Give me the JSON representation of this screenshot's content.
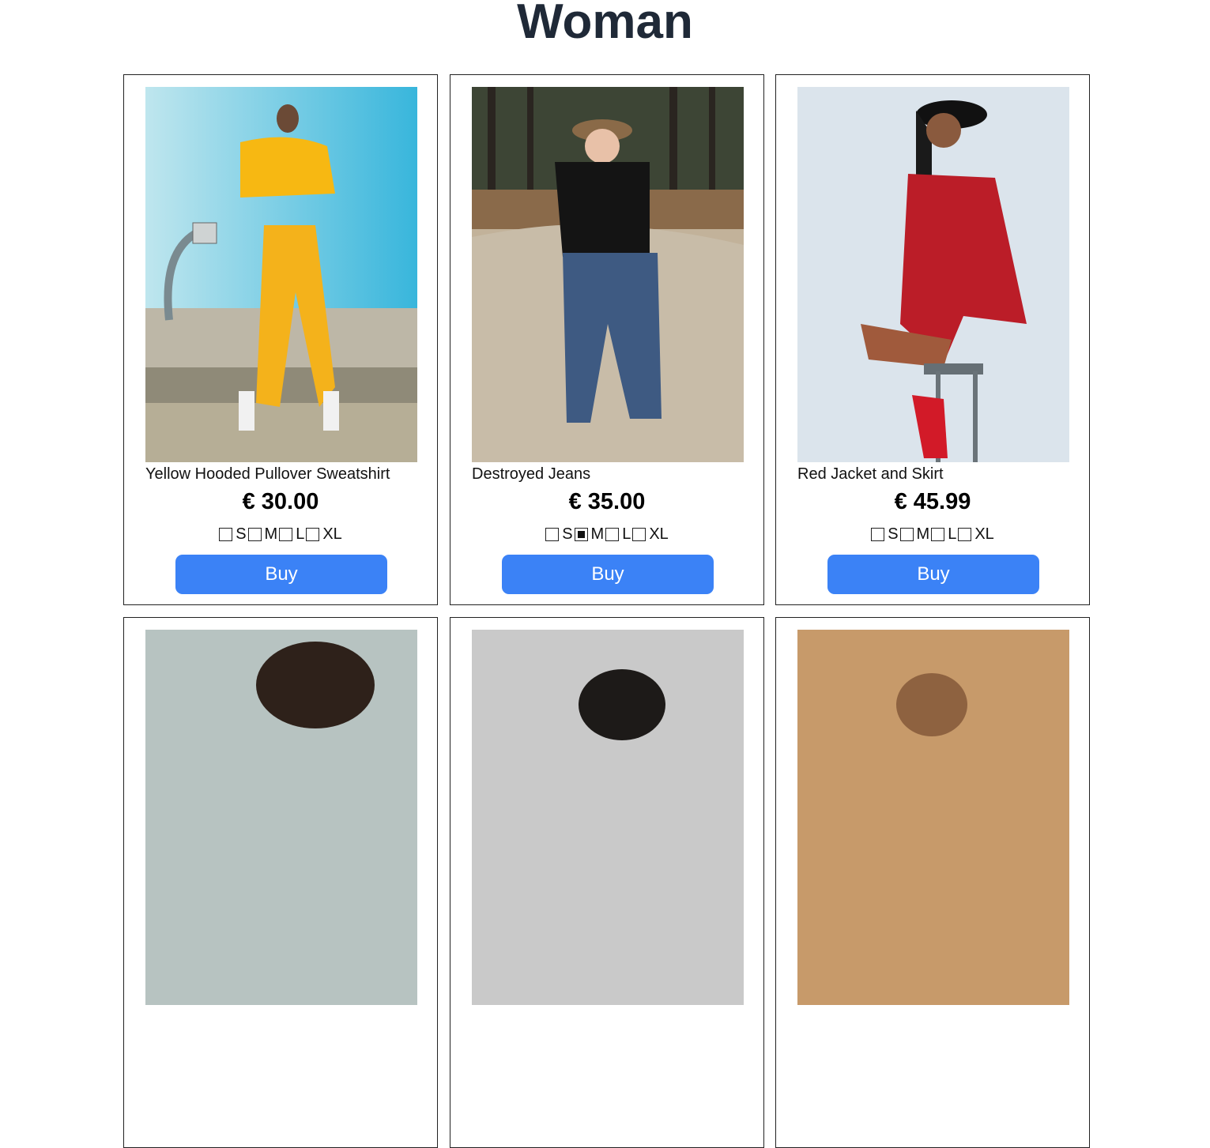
{
  "page": {
    "title": "Woman"
  },
  "colors": {
    "accent": "#3b82f6",
    "title": "#1f2937"
  },
  "products": [
    {
      "name": "Yellow Hooded Pullover Sweatshirt",
      "price": "€ 30.00",
      "sizes": [
        "S",
        "M",
        "L",
        "XL"
      ],
      "selected": [
        false,
        false,
        false,
        false
      ],
      "buy_label": "Buy"
    },
    {
      "name": "Destroyed Jeans",
      "price": "€ 35.00",
      "sizes": [
        "S",
        "M",
        "L",
        "XL"
      ],
      "selected": [
        false,
        true,
        false,
        false
      ],
      "buy_label": "Buy"
    },
    {
      "name": "Red Jacket and Skirt",
      "price": "€ 45.99",
      "sizes": [
        "S",
        "M",
        "L",
        "XL"
      ],
      "selected": [
        false,
        false,
        false,
        false
      ],
      "buy_label": "Buy"
    },
    {
      "name": "",
      "price": "",
      "sizes": [],
      "selected": [],
      "buy_label": ""
    },
    {
      "name": "",
      "price": "",
      "sizes": [],
      "selected": [],
      "buy_label": ""
    },
    {
      "name": "",
      "price": "",
      "sizes": [],
      "selected": [],
      "buy_label": ""
    }
  ]
}
